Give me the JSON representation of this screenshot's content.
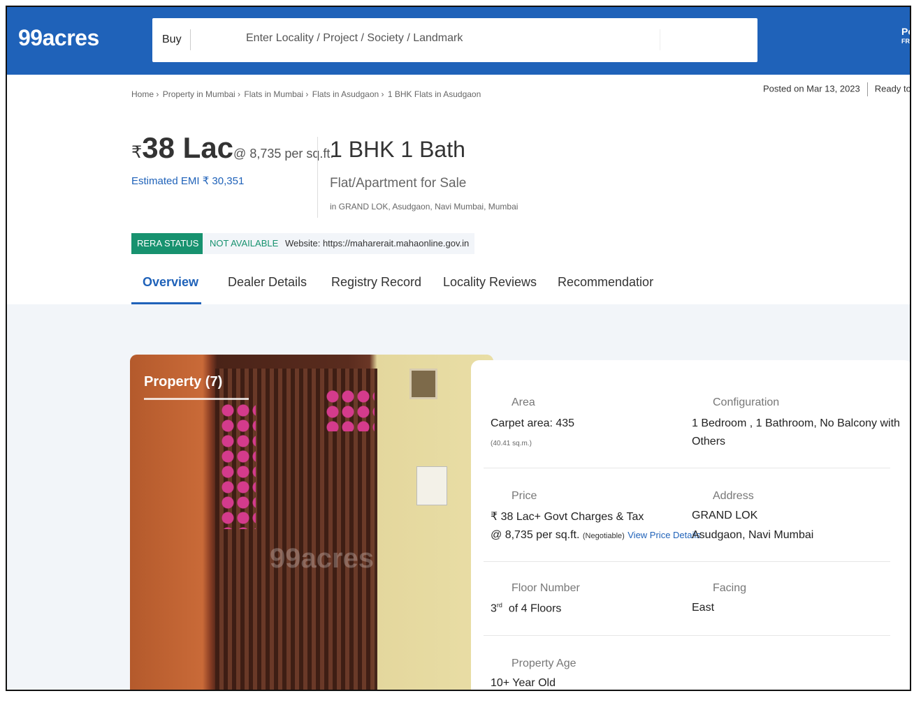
{
  "header": {
    "logo": "99acres",
    "search_type": "Buy",
    "search_placeholder": "Enter Locality / Project / Society / Landmark",
    "right_text": "Po",
    "right_sub": "FR"
  },
  "breadcrumb": [
    "Home ›",
    "Property in Mumbai ›",
    "Flats in Mumbai ›",
    "Flats in Asudgaon ›",
    "1 BHK Flats in Asudgaon"
  ],
  "posted": {
    "date": "Posted on Mar 13, 2023",
    "status": "Ready to m"
  },
  "listing": {
    "rupee": "₹",
    "price": "38 Lac",
    "per_sqft": "@ 8,735 per sq.ft.",
    "emi": "Estimated EMI ₹ 30,351",
    "config": "1 BHK 1 Bath",
    "type": "Flat/Apartment for Sale",
    "location": "in GRAND LOK, Asudgaon, Navi Mumbai, Mumbai"
  },
  "rera": {
    "badge": "RERA STATUS",
    "status": "NOT AVAILABLE",
    "website": "Website: https://maharerait.mahaonline.gov.in"
  },
  "tabs": [
    "Overview",
    "Dealer Details",
    "Registry Record",
    "Locality Reviews",
    "Recommendatior"
  ],
  "photo": {
    "label": "Property (7)",
    "watermark": "99acres"
  },
  "details": {
    "area_label": "Area",
    "area_value": "Carpet area: 435",
    "area_sub": "(40.41 sq.m.)",
    "config_label": "Configuration",
    "config_value_1": "1 Bedroom , 1 Bathroom, No Balcony with",
    "config_value_2": "Others",
    "price_label": "Price",
    "price_value": "₹ 38 Lac+ Govt Charges & Tax",
    "price_sqft": "@ 8,735 per sq.ft.",
    "price_negotiable": "(Negotiable)",
    "price_link": "View Price Details",
    "address_label": "Address",
    "address_value_1": "GRAND LOK",
    "address_value_2": "Asudgaon, Navi Mumbai",
    "floor_label": "Floor Number",
    "floor_num": "3",
    "floor_sup": "rd",
    "floor_of": "of 4 Floors",
    "facing_label": "Facing",
    "facing_value": "East",
    "age_label": "Property Age",
    "age_value": "10+ Year Old"
  },
  "colors": {
    "brand_blue": "#1f62b9",
    "rera_green": "#17926f",
    "content_bg": "#f2f5f9"
  }
}
